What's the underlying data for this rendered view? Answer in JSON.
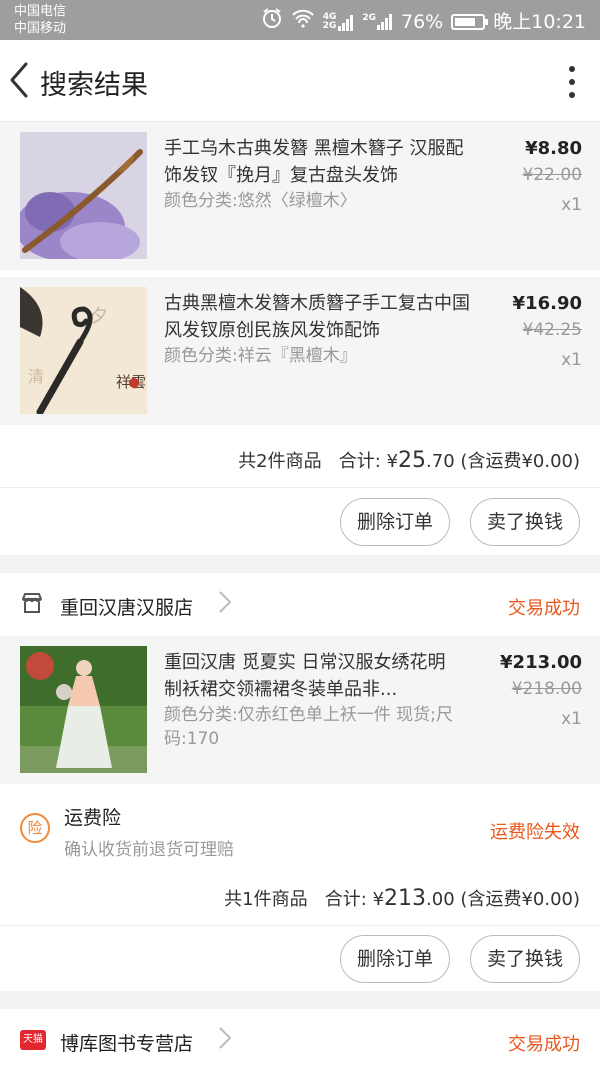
{
  "status_bar": {
    "carrier1": "中国电信",
    "carrier2": "中国移动",
    "net_label_top": "4G",
    "net_label_bottom": "2G",
    "net_label2": "2G",
    "battery": "76%",
    "battery_level": 0.76,
    "time": "晚上10:21"
  },
  "header": {
    "title": "搜索结果"
  },
  "order1": {
    "items": [
      {
        "title": "手工乌木古典发簪 黑檀木簪子 汉服配饰发钗『挽月』复古盘头发饰",
        "spec": "颜色分类:悠然〈绿檀木〉",
        "price": "¥8.80",
        "original_price": "¥22.00",
        "qty": "x1"
      },
      {
        "title": "古典黑檀木发簪木质簪子手工复古中国风发钗原创民族风发饰配饰",
        "spec": "颜色分类:祥云『黑檀木』",
        "price": "¥16.90",
        "original_price": "¥42.25",
        "qty": "x1",
        "image_text": "祥雲"
      }
    ],
    "summary_count": "共2件商品",
    "summary_label": "合计: ¥",
    "summary_int": "25",
    "summary_dec": ".70",
    "summary_shipping": "(含运费¥0.00)",
    "delete_btn": "删除订单",
    "resell_btn": "卖了换钱"
  },
  "order2": {
    "store_name": "重回汉唐汉服店",
    "status": "交易成功",
    "item": {
      "title": "重回汉唐 觅夏实 日常汉服女绣花明制袄裙交领襦裙冬装单品非...",
      "spec": "颜色分类:仅赤红色单上袄一件 现货;尺码:170",
      "price": "¥213.00",
      "original_price": "¥218.00",
      "qty": "x1"
    },
    "insurance": {
      "icon_text": "险",
      "title": "运费险",
      "subtitle": "确认收货前退货可理赔",
      "status": "运费险失效"
    },
    "summary_count": "共1件商品",
    "summary_label": "合计: ¥",
    "summary_int": "213",
    "summary_dec": ".00",
    "summary_shipping": "(含运费¥0.00)",
    "delete_btn": "删除订单",
    "resell_btn": "卖了换钱"
  },
  "order3": {
    "store_badge": "天猫",
    "store_name": "博库图书专营店",
    "status": "交易成功"
  },
  "colors": {
    "accent": "#e8581c",
    "status_bar": "#9e9e9e"
  }
}
